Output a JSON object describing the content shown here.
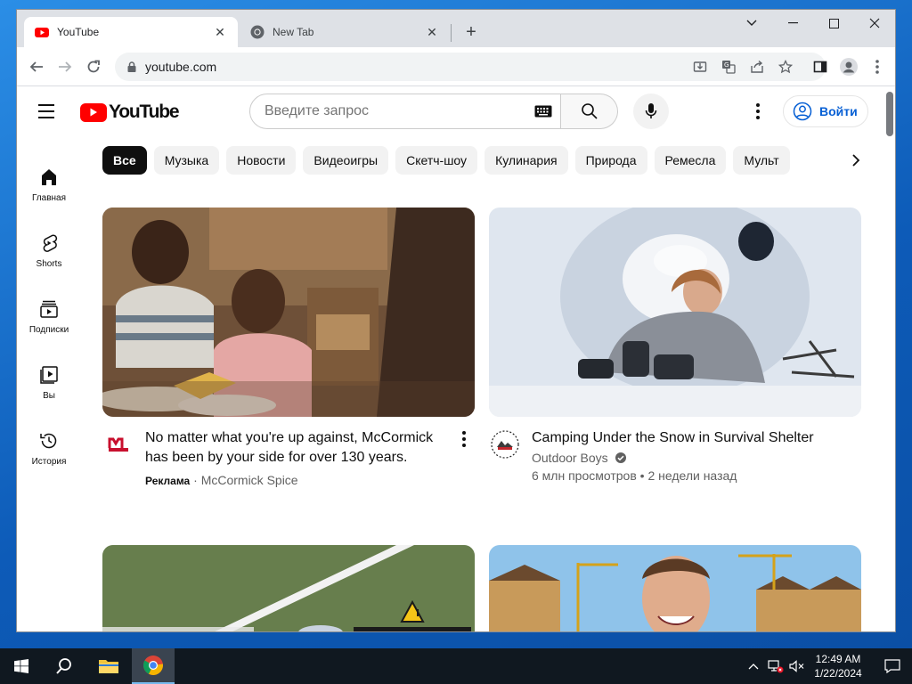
{
  "browser": {
    "tabs": [
      {
        "title": "YouTube",
        "favicon": "youtube-icon",
        "active": true
      },
      {
        "title": "New Tab",
        "favicon": "chrome-icon",
        "active": false
      }
    ],
    "url": "youtube.com"
  },
  "youtube": {
    "logo_text": "YouTube",
    "search_placeholder": "Введите запрос",
    "signin_label": "Войти",
    "sidebar": [
      {
        "label": "Главная",
        "icon": "home-icon"
      },
      {
        "label": "Shorts",
        "icon": "shorts-icon"
      },
      {
        "label": "Подписки",
        "icon": "subscriptions-icon"
      },
      {
        "label": "Вы",
        "icon": "you-icon"
      },
      {
        "label": "История",
        "icon": "history-icon"
      }
    ],
    "chips": [
      "Все",
      "Музыка",
      "Новости",
      "Видеоигры",
      "Скетч-шоу",
      "Кулинария",
      "Природа",
      "Ремесла",
      "Мульт"
    ],
    "videos": [
      {
        "title": "No matter what you're up against, McCormick has been by your side for over 130 years.",
        "ad_label": "Реклама",
        "channel": "McCormick Spice"
      },
      {
        "title": "Camping Under the Snow in Survival Shelter",
        "channel": "Outdoor Boys",
        "stats": "6 млн просмотров • 2 недели назад"
      }
    ]
  },
  "taskbar": {
    "time": "12:49 AM",
    "date": "1/22/2024"
  },
  "colors": {
    "brand_red": "#ff0000",
    "link_blue": "#065fd4",
    "taskbar": "#101820"
  }
}
